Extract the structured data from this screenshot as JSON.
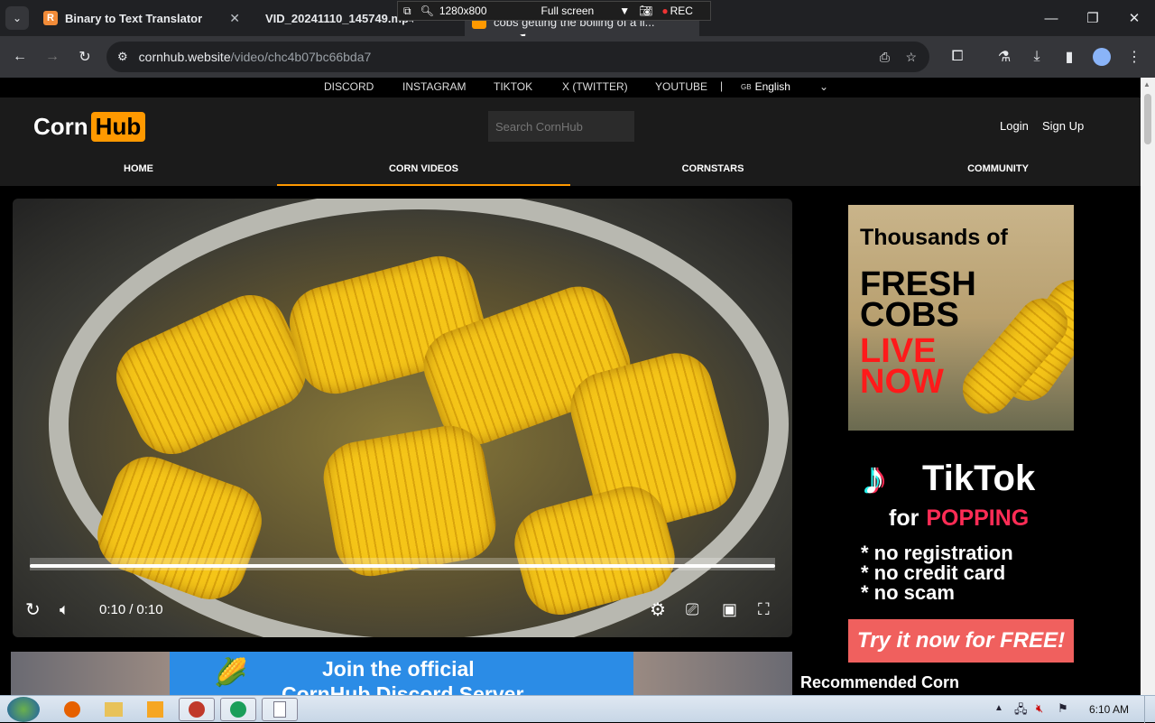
{
  "browser": {
    "tabs": [
      {
        "title": "Binary to Text Translator",
        "favicon": "R"
      },
      {
        "title": "VID_20241110_145749.mp4",
        "favicon": "video-file-icon"
      },
      {
        "title": "cobs getting the boiling of a li...",
        "favicon": "cornhub-icon"
      }
    ],
    "url_host": "cornhub.website",
    "url_path": "/video/chc4b07bc66bda7"
  },
  "recorder": {
    "resolution": "1280x800",
    "mode": "Full screen",
    "rec_label": "REC"
  },
  "site": {
    "social_links": [
      "DISCORD",
      "INSTAGRAM",
      "TIKTOK",
      "X (TWITTER)",
      "YOUTUBE"
    ],
    "separator": "|",
    "language": "English",
    "language_flag": "GB",
    "logo_left": "Corn",
    "logo_right": "Hub",
    "search_placeholder": "Search CornHub",
    "login": "Login",
    "signup": "Sign Up",
    "nav": [
      {
        "label": "HOME",
        "active": false
      },
      {
        "label": "CORN VIDEOS",
        "active": true
      },
      {
        "label": "CORNSTARS",
        "active": false
      },
      {
        "label": "COMMUNITY",
        "active": false
      }
    ],
    "accent_color": "#ff9900"
  },
  "player": {
    "current_time": "0:10",
    "separator": "/",
    "duration": "0:10",
    "progress": 1.0
  },
  "ad1": {
    "line1": "Thousands of",
    "line2": "FRESH",
    "line3": "COBS",
    "line4": "LIVE",
    "line5": "NOW"
  },
  "ad2": {
    "brand": "TikTok",
    "sub_prefix": "for",
    "sub_highlight": "POPPING",
    "bullets": [
      "* no registration",
      "* no credit card",
      "* no scam"
    ],
    "cta": "Try it now for FREE!"
  },
  "discord_banner": {
    "line1": "Join the official",
    "line2": "CornHub Discord Server"
  },
  "recommended_title": "Recommended Corn",
  "taskbar": {
    "time": "6:10 AM"
  }
}
